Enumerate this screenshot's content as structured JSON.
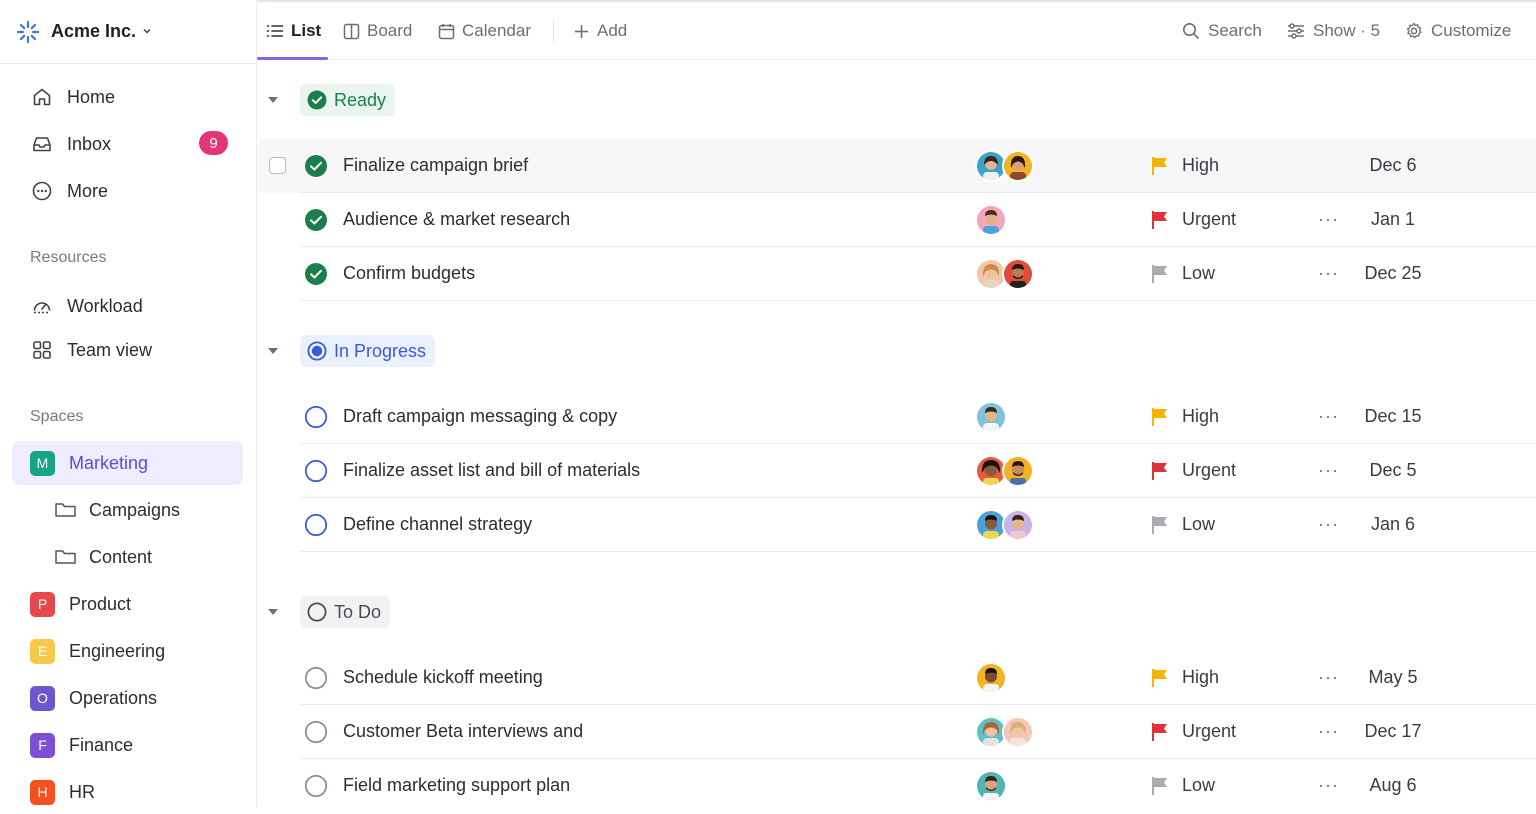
{
  "workspace": {
    "name": "Acme Inc.",
    "chevron": "⌄"
  },
  "sidebar": {
    "nav": [
      {
        "label": "Home",
        "icon": "home-icon"
      },
      {
        "label": "Inbox",
        "icon": "inbox-icon",
        "badge": "9"
      },
      {
        "label": "More",
        "icon": "more-icon"
      }
    ],
    "resources_label": "Resources",
    "resources": [
      {
        "label": "Workload",
        "icon": "workload-icon"
      },
      {
        "label": "Team view",
        "icon": "grid-icon"
      }
    ],
    "spaces_label": "Spaces",
    "spaces": [
      {
        "letter": "M",
        "label": "Marketing",
        "color": "#17a589",
        "active": true
      },
      {
        "letter": "P",
        "label": "Product",
        "color": "#e5484d"
      },
      {
        "letter": "E",
        "label": "Engineering",
        "color": "#f7c94b"
      },
      {
        "letter": "O",
        "label": "Operations",
        "color": "#6e56cf"
      },
      {
        "letter": "F",
        "label": "Finance",
        "color": "#7b4fd6"
      },
      {
        "letter": "H",
        "label": "HR",
        "color": "#f4511e"
      }
    ],
    "folders": [
      {
        "label": "Campaigns",
        "icon": "folder-icon"
      },
      {
        "label": "Content",
        "icon": "folder-icon"
      }
    ]
  },
  "toolbar": {
    "tabs": [
      {
        "label": "List",
        "icon": "list-icon",
        "active": true
      },
      {
        "label": "Board",
        "icon": "board-icon"
      },
      {
        "label": "Calendar",
        "icon": "calendar-icon"
      },
      {
        "label": "Add",
        "icon": "plus-icon"
      }
    ],
    "search_label": "Search",
    "show_label": "Show · 5",
    "customize_label": "Customize"
  },
  "groups": [
    {
      "status": "Ready",
      "color": "#1b7f4b",
      "bg": "#e9f5ee",
      "tasks": [
        {
          "name": "Finalize campaign brief",
          "priority": "High",
          "date": "Dec 6",
          "assignees": 2
        },
        {
          "name": "Audience & market research",
          "priority": "Urgent",
          "date": "Jan 1",
          "assignees": 1
        },
        {
          "name": "Confirm budgets",
          "priority": "Low",
          "date": "Dec 25",
          "assignees": 2
        }
      ]
    },
    {
      "status": "In Progress",
      "color": "#3a5bd9",
      "bg": "#eaf0fd",
      "tasks": [
        {
          "name": "Draft campaign messaging & copy",
          "priority": "High",
          "date": "Dec 15",
          "assignees": 1
        },
        {
          "name": "Finalize asset list and bill of materials",
          "priority": "Urgent",
          "date": "Dec 5",
          "assignees": 2
        },
        {
          "name": "Define channel strategy",
          "priority": "Low",
          "date": "Jan 6",
          "assignees": 2
        }
      ]
    },
    {
      "status": "To Do",
      "color": "#4a4c52",
      "bg": "#f2f2f4",
      "tasks": [
        {
          "name": "Schedule kickoff meeting",
          "priority": "High",
          "date": "May 5",
          "assignees": 1
        },
        {
          "name": "Customer Beta interviews and",
          "priority": "Urgent",
          "date": "Dec 17",
          "assignees": 2
        },
        {
          "name": "Field marketing support plan",
          "priority": "Low",
          "date": "Aug 6",
          "assignees": 1
        }
      ]
    }
  ],
  "priority_colors": {
    "High": "#f5b400",
    "Urgent": "#e0313d",
    "Low": "#a9abb2"
  },
  "row_more": "···"
}
